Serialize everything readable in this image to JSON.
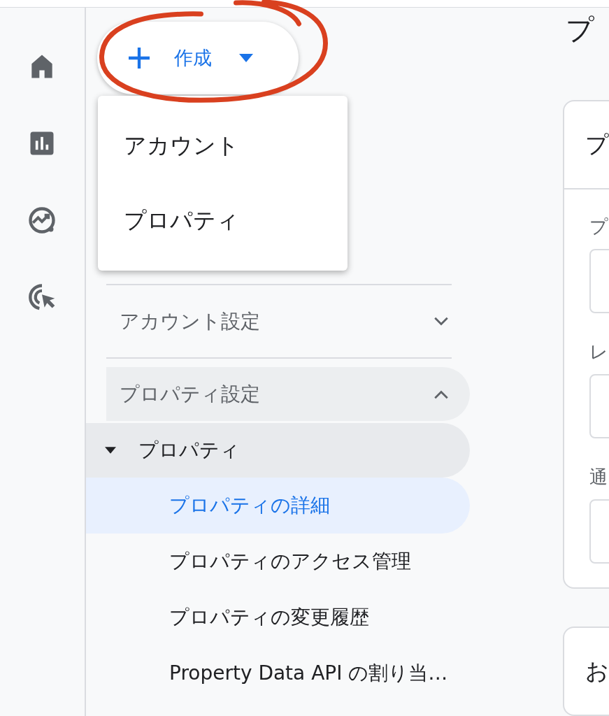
{
  "create_button": {
    "label": "作成"
  },
  "create_menu": {
    "items": [
      "アカウント",
      "プロパティ"
    ]
  },
  "nav": {
    "sections": [
      {
        "label": "アカウント設定",
        "expanded": false
      },
      {
        "label": "プロパティ設定",
        "expanded": true,
        "children": [
          {
            "label": "プロパティ",
            "expanded": true,
            "children": [
              {
                "label": "プロパティの詳細",
                "selected": true
              },
              {
                "label": "プロパティのアクセス管理",
                "selected": false
              },
              {
                "label": "プロパティの変更履歴",
                "selected": false
              },
              {
                "label": "Property Data API の割り当…",
                "selected": false
              }
            ]
          }
        ]
      }
    ]
  },
  "main": {
    "title": "プ",
    "cards": [
      {
        "title": "プ",
        "fields": [
          {
            "label": "プ"
          },
          {
            "label": "レ"
          },
          {
            "label": "通"
          }
        ]
      },
      {
        "title": "お"
      }
    ]
  }
}
